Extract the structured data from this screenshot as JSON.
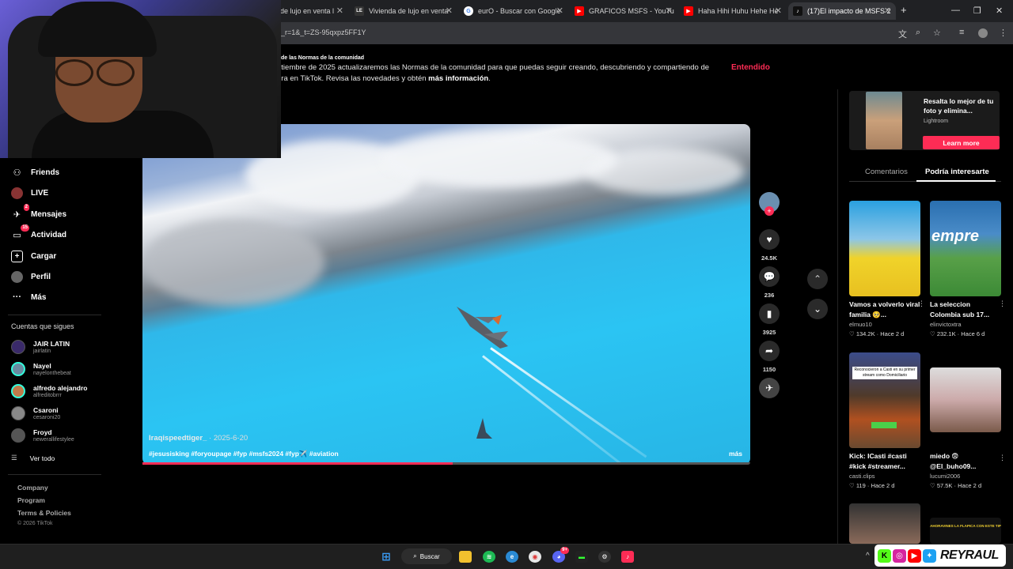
{
  "browser": {
    "tabs": [
      {
        "title": "de lujo en venta l",
        "icon": "page-icon"
      },
      {
        "title": "Vivienda de lujo en venta",
        "icon": "page-icon"
      },
      {
        "title": "eurO - Buscar con Google",
        "icon": "google-icon"
      },
      {
        "title": "GRAFICOS MSFS - YouTu",
        "icon": "youtube-icon"
      },
      {
        "title": "Haha Hihi Huhu Hehe He",
        "icon": "youtube-icon"
      },
      {
        "title": "(17)El impacto de MSFS 2",
        "icon": "tiktok-icon"
      }
    ],
    "url": "_r=1&_t=ZS-95qxpz5FF1Y"
  },
  "notice": {
    "title": "de las Normas de la comunidad",
    "line1": "ptiembre de 2025 actualizaremos las Normas de la comunidad para que puedas seguir creando, descubriendo y compartiendo de",
    "line2": "era en TikTok. Revisa las novedades y obtén ",
    "link": "más información",
    "button": "Entendido"
  },
  "nav": {
    "items": [
      {
        "label": "Friends",
        "icon": "friends-icon"
      },
      {
        "label": "LIVE",
        "icon": "live-icon"
      },
      {
        "label": "Mensajes",
        "icon": "messages-icon",
        "badge": "2"
      },
      {
        "label": "Actividad",
        "icon": "activity-icon",
        "badge": "15"
      },
      {
        "label": "Cargar",
        "icon": "upload-icon"
      },
      {
        "label": "Perfil",
        "icon": "profile-icon"
      },
      {
        "label": "Más",
        "icon": "more-icon"
      }
    ],
    "following_header": "Cuentas que sigues",
    "following": [
      {
        "name": "JAIR LATIN",
        "handle": "jairlatin",
        "color": "#3a2a6a"
      },
      {
        "name": "Nayel",
        "handle": "nayelonthebeat",
        "color": "#6a8aa0"
      },
      {
        "name": "alfredo alejandro",
        "handle": "alfreditobrrr",
        "color": "#c07a4a"
      },
      {
        "name": "Csaroni",
        "handle": "cesaroni20",
        "color": "#888888"
      },
      {
        "name": "Froyd",
        "handle": "newerallifestylee",
        "color": "#555555"
      }
    ],
    "see_all": "Ver todo",
    "footer": [
      "Company",
      "Program",
      "Terms & Policies"
    ],
    "copyright": "© 2026 TikTok"
  },
  "video": {
    "author": "Iraqispeedtiger_",
    "date": " · 2025-6-20",
    "hashtags": "#jesusisking #foryoupage #fyp #msfs2024 #fyp✈️ #aviation",
    "more": "más",
    "progress": 0.51
  },
  "actions": {
    "likes": "24.5K",
    "comments": "236",
    "saves": "3925",
    "shares": "1150"
  },
  "ad": {
    "text": "Resalta lo mejor de tu foto y elimina...",
    "brand": "Lightroom",
    "button": "Learn more"
  },
  "right_tabs": {
    "comments": "Comentarios",
    "suggested": "Podría interesarte"
  },
  "cards": [
    {
      "title": "Vamos a volverlo viral familia 🥺...",
      "user": "elmuo10",
      "likes": "134.2K",
      "age": "Hace 2 d"
    },
    {
      "title": "La seleccion Colombia sub 17...",
      "user": "elinvictoxtra",
      "likes": "232.1K",
      "age": "Hace 6 d"
    },
    {
      "title": "Kick: ICasti #casti #kick #streamer...",
      "user": "casti.clips",
      "likes": "119",
      "age": "Hace 2 d",
      "overlay": "Reconocieron a Casti en su primer stream como Domiciliario"
    },
    {
      "title": "miedo 😨 @El_buho09...",
      "user": "lucumi2006",
      "likes": "57.5K",
      "age": "Hace 2 d"
    }
  ],
  "bottom_cards": {
    "overlay": "AHORAVINES LA FLAPICA CON ESTE TIP"
  },
  "taskbar": {
    "search": "Buscar",
    "discord_badge": "9+"
  },
  "overlay_logo": "REYRAUL"
}
